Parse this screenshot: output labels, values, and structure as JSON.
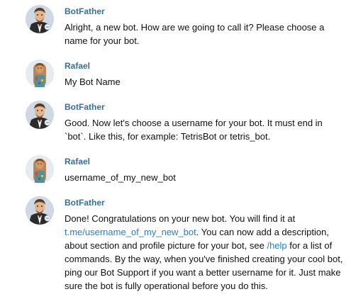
{
  "messages": [
    {
      "author": "BotFather",
      "avatar_icon": "botfather-avatar",
      "text": "Alright, a new bot. How are we going to call it? Please choose a name for your bot."
    },
    {
      "author": "Rafael",
      "avatar_icon": "rafael-avatar",
      "text": "My Bot Name"
    },
    {
      "author": "BotFather",
      "avatar_icon": "botfather-avatar",
      "text": "Good. Now let's choose a username for your bot. It must end in `bot`. Like this, for example: TetrisBot or tetris_bot."
    },
    {
      "author": "Rafael",
      "avatar_icon": "rafael-avatar",
      "text": "username_of_my_new_bot"
    },
    {
      "author": "BotFather",
      "avatar_icon": "botfather-avatar",
      "text_part1": "Done! Congratulations on your new bot. You will find it at ",
      "link1": "t.me/username_of_my_new_bot",
      "text_part2": ". You can now add a description, about section and profile picture for your bot, see ",
      "link2": "/help",
      "text_part3": " for a list of commands. By the way, when you've finished creating your cool bot, ping our Bot Support if you want a better username for it. Just make sure the bot is fully operational before you do this."
    }
  ],
  "colors": {
    "author_name": "#3a6d99",
    "link": "#2481cc",
    "text": "#111111",
    "background": "#ffffff"
  }
}
